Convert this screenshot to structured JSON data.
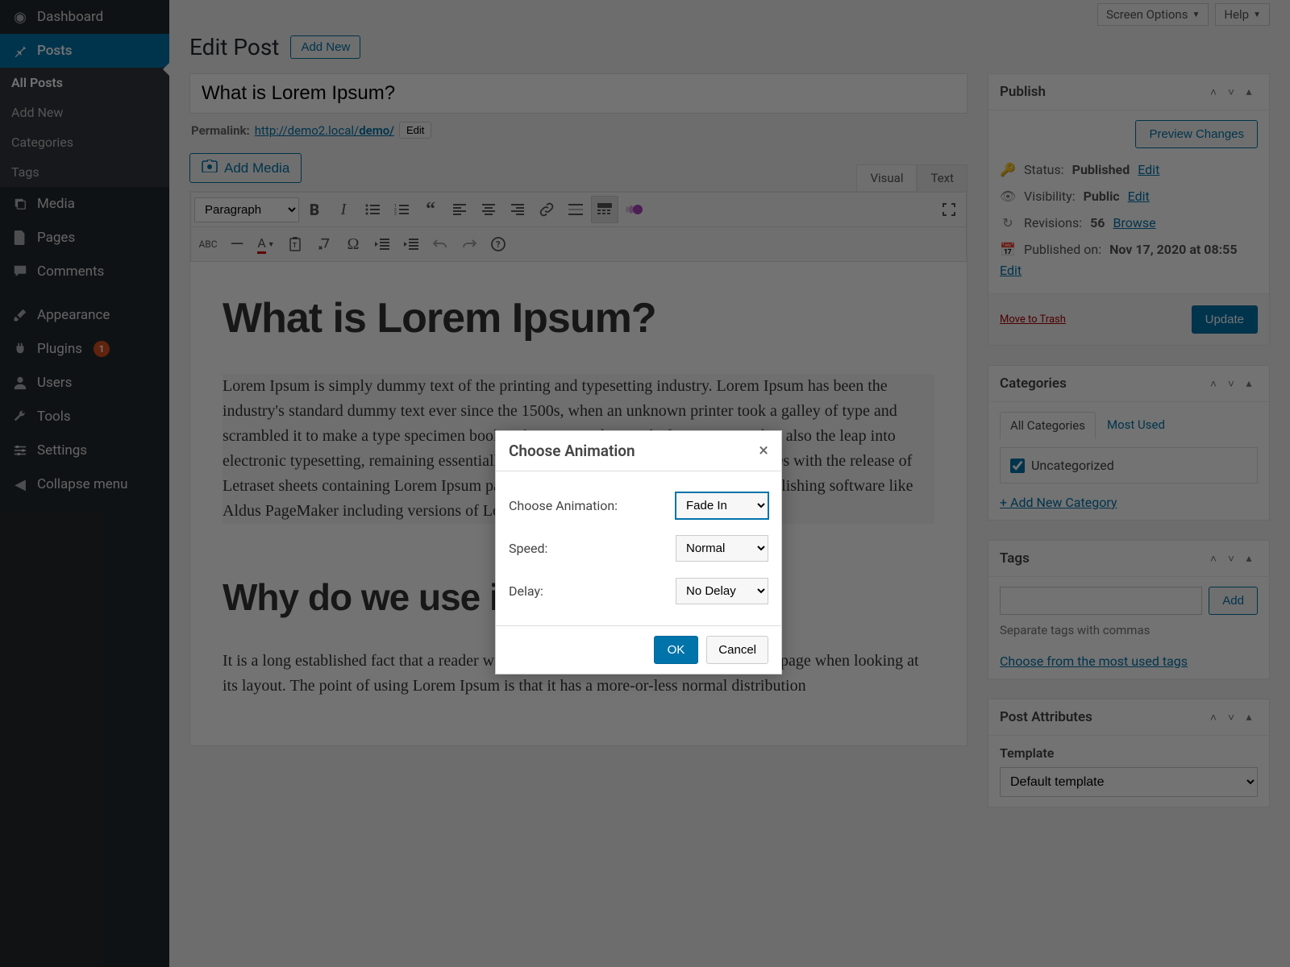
{
  "sidebar": {
    "dashboard": "Dashboard",
    "posts": "Posts",
    "all_posts": "All Posts",
    "add_new": "Add New",
    "categories": "Categories",
    "tags": "Tags",
    "media": "Media",
    "pages": "Pages",
    "comments": "Comments",
    "appearance": "Appearance",
    "plugins": "Plugins",
    "plugins_badge": "1",
    "users": "Users",
    "tools": "Tools",
    "settings": "Settings",
    "collapse": "Collapse menu"
  },
  "topbar": {
    "screen_options": "Screen Options",
    "help": "Help"
  },
  "page": {
    "title": "Edit Post",
    "add_new": "Add New"
  },
  "post": {
    "title": "What is Lorem Ipsum?",
    "permalink_label": "Permalink:",
    "permalink_base": "http://demo2.local/",
    "permalink_slug": "demo/",
    "edit": "Edit"
  },
  "editor": {
    "add_media": "Add Media",
    "tab_visual": "Visual",
    "tab_text": "Text",
    "format_select": "Paragraph",
    "heading1": "What is Lorem Ipsum?",
    "para1": "Lorem Ipsum is simply dummy text of the printing and typesetting industry. Lorem Ipsum has been the industry's standard dummy text ever since the 1500s, when an unknown printer took a galley of type and scrambled it to make a type specimen book. It has survived not only five centuries, but also the leap into electronic typesetting, remaining essentially unchanged. It was popularised in the 1960s with the release of Letraset sheets containing Lorem Ipsum passages, and more recently with desktop publishing software like Aldus PageMaker including versions of Lorem Ipsum.",
    "heading2": "Why do we use it?",
    "para2": "It is a long established fact that a reader will be distracted by the readable content of a page when looking at its layout. The point of using Lorem Ipsum is that it has a more-or-less normal distribution"
  },
  "publish": {
    "title": "Publish",
    "preview": "Preview Changes",
    "status_label": "Status:",
    "status_value": "Published",
    "visibility_label": "Visibility:",
    "visibility_value": "Public",
    "revisions_label": "Revisions:",
    "revisions_value": "56",
    "browse": "Browse",
    "published_label": "Published on:",
    "published_value": "Nov 17, 2020 at 08:55",
    "edit": "Edit",
    "trash": "Move to Trash",
    "update": "Update"
  },
  "categories": {
    "title": "Categories",
    "tab_all": "All Categories",
    "tab_most": "Most Used",
    "item1": "Uncategorized",
    "add_new": "+ Add New Category"
  },
  "tags": {
    "title": "Tags",
    "add": "Add",
    "hint": "Separate tags with commas",
    "choose": "Choose from the most used tags"
  },
  "attributes": {
    "title": "Post Attributes",
    "template_label": "Template",
    "template_value": "Default template"
  },
  "modal": {
    "title": "Choose Animation",
    "field1_label": "Choose Animation:",
    "field1_value": "Fade In",
    "field2_label": "Speed:",
    "field2_value": "Normal",
    "field3_label": "Delay:",
    "field3_value": "No Delay",
    "ok": "OK",
    "cancel": "Cancel"
  }
}
